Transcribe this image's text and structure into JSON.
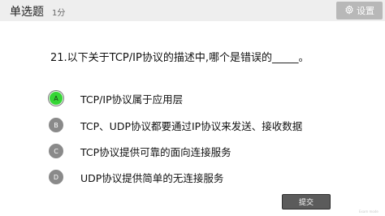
{
  "header": {
    "title": "单选题",
    "score": "1分",
    "settings_label": "设置",
    "settings_icon": "gear-icon"
  },
  "question": {
    "text": "21.以下关于TCP/IP协议的描述中,哪个是错误的_____。"
  },
  "options": [
    {
      "letter": "A",
      "text": "TCP/IP协议属于应用层",
      "selected": true
    },
    {
      "letter": "B",
      "text": "TCP、UDP协议都要通过IP协议来发送、接收数据",
      "selected": false
    },
    {
      "letter": "C",
      "text": "TCP协议提供可靠的面向连接服务",
      "selected": false
    },
    {
      "letter": "D",
      "text": "UDP协议提供简单的无连接服务",
      "selected": false
    }
  ],
  "submit_label": "提交",
  "watermark": "Exam mode",
  "colors": {
    "selected": "#35d635",
    "badge": "#8a8a8a",
    "header_bg": "#eeeeee",
    "settings_bg": "#b8b8b8",
    "submit_bg": "#5b5b5b"
  }
}
